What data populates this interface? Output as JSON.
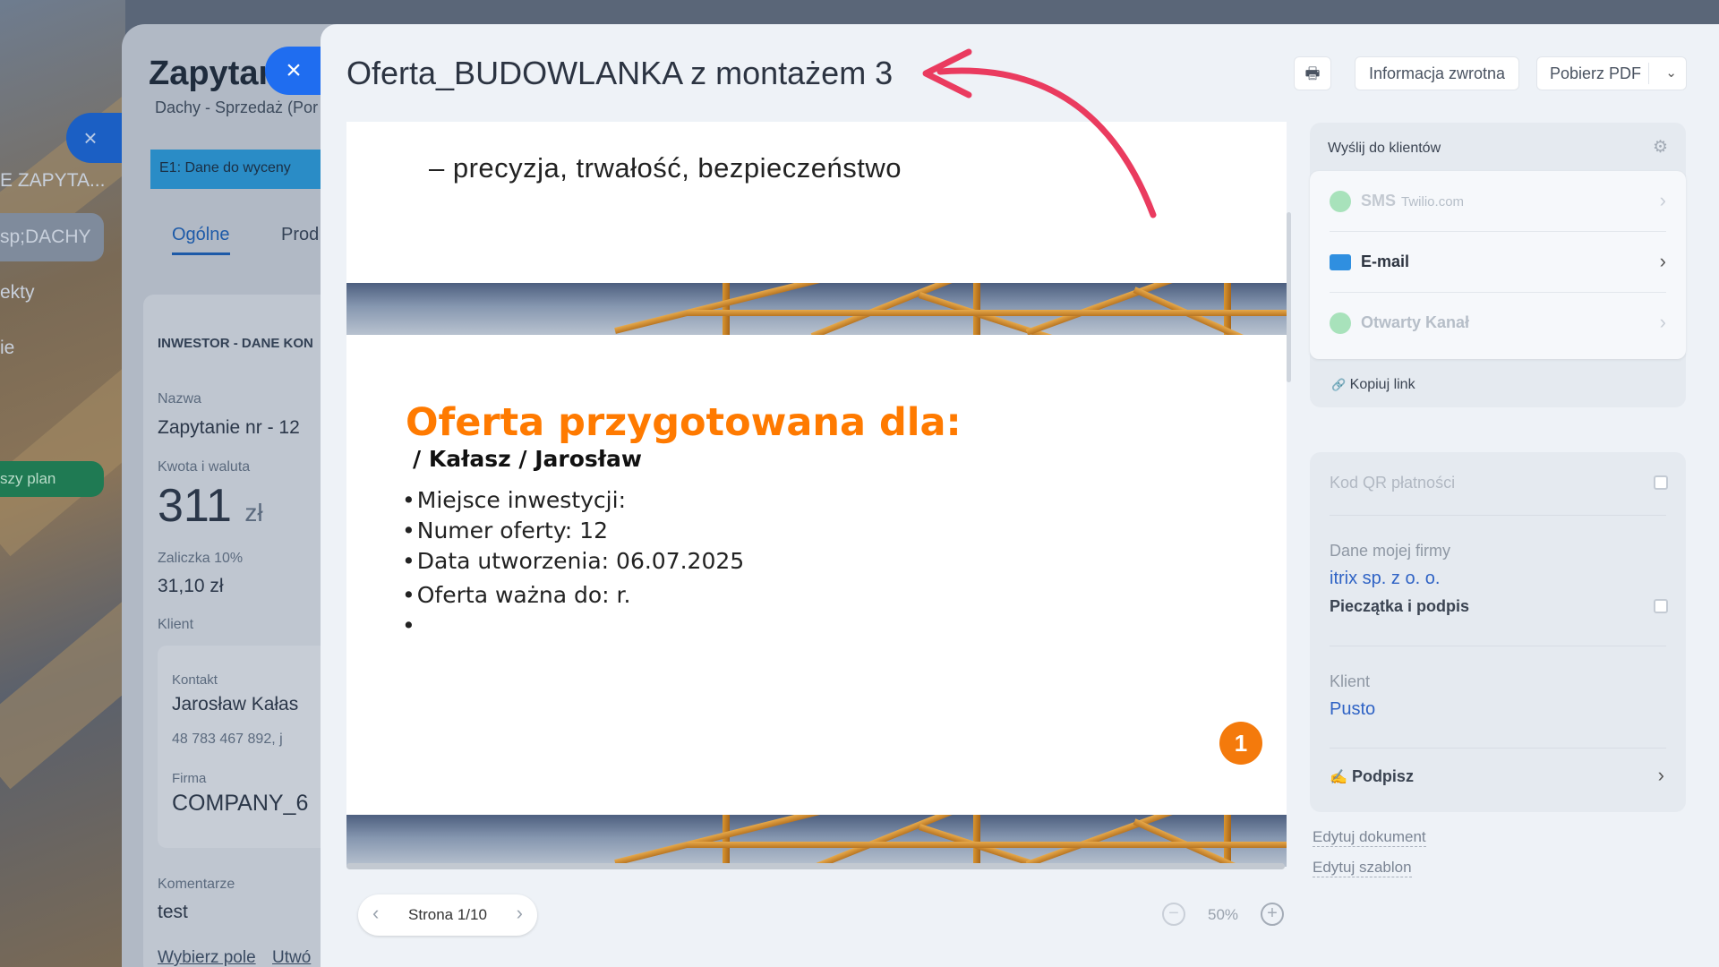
{
  "background": {
    "left_labels": [
      "E ZAPYTA...",
      "sp;DACHY",
      "ekty",
      "ie",
      "szy plan"
    ],
    "panel": {
      "title": "Zapytan",
      "subtitle": "Dachy - Sprzedaż (Por",
      "stage": "E1: Dane do wyceny",
      "tabs": [
        "Ogólne",
        "Prod"
      ],
      "section_title": "INWESTOR - DANE KON",
      "name_label": "Nazwa",
      "name_value": "Zapytanie nr - 12",
      "amount_label": "Kwota i waluta",
      "amount_value": "311",
      "amount_currency": "zł",
      "deposit_label": "Zaliczka 10%",
      "deposit_value": "31,10 zł",
      "client_label": "Klient",
      "contact_label": "Kontakt",
      "contact_value": "Jarosław Kałas",
      "contact_phone": "48 783 467 892, j",
      "company_label": "Firma",
      "company_value": "COMPANY_6",
      "comments_label": "Komentarze",
      "comments_value": "test",
      "footer_links": [
        "Wybierz pole",
        "Utwó"
      ]
    }
  },
  "modal": {
    "title": "Oferta_BUDOWLANKA z montażem 3",
    "close_icon": "×",
    "document": {
      "line1": "– precyzja, trwałość, bezpieczeństwo",
      "heading": "Oferta przygotowana dla:",
      "client": "/ Kałasz / Jarosław",
      "bullets": [
        "Miejsce inwestycji:",
        "Numer oferty: 12",
        "Data utworzenia: 06.07.2025",
        "Oferta ważna do:  r.",
        ""
      ],
      "page_badge": "1"
    },
    "pager": {
      "label": "Strona 1/10",
      "prev": "‹",
      "next": "›"
    },
    "zoom": {
      "value": "50%",
      "minus": "−",
      "plus": "+"
    }
  },
  "actions": {
    "print_icon": "🖶",
    "feedback": "Informacja zwrotna",
    "download_pdf": "Pobierz PDF",
    "dropdown_icon": "⌄"
  },
  "send": {
    "header": "Wyślij do klientów",
    "gear_icon": "⚙",
    "channels": [
      {
        "label": "SMS",
        "provider": "Twilio.com",
        "color": "#c3c9d1",
        "icon_color": "#a8e2bb"
      },
      {
        "label": "E-mail",
        "provider": "",
        "color": "#2d3440",
        "icon_color": "#2f8fe0"
      },
      {
        "label": "Otwarty Kanał",
        "provider": "",
        "color": "#b6bec8",
        "icon_color": "#a8e2bb"
      }
    ],
    "copy_link": "Kopiuj link",
    "link_icon": "🔗"
  },
  "options": {
    "qr_label": "Kod QR płatności",
    "company_label": "Dane mojej firmy",
    "company_value": "itrix sp. z o. o.",
    "stamp_label": "Pieczątka i podpis",
    "client_label": "Klient",
    "client_value": "Pusto",
    "sign_label": "Podpisz",
    "sign_icon": "✍"
  },
  "edit_links": [
    "Edytuj dokument",
    "Edytuj szablon"
  ],
  "colors": {
    "accent_blue": "#1f6df0",
    "offer_orange": "#ff7a00",
    "annotation_red": "#ea3b5f",
    "link_blue": "#2f63c5"
  }
}
